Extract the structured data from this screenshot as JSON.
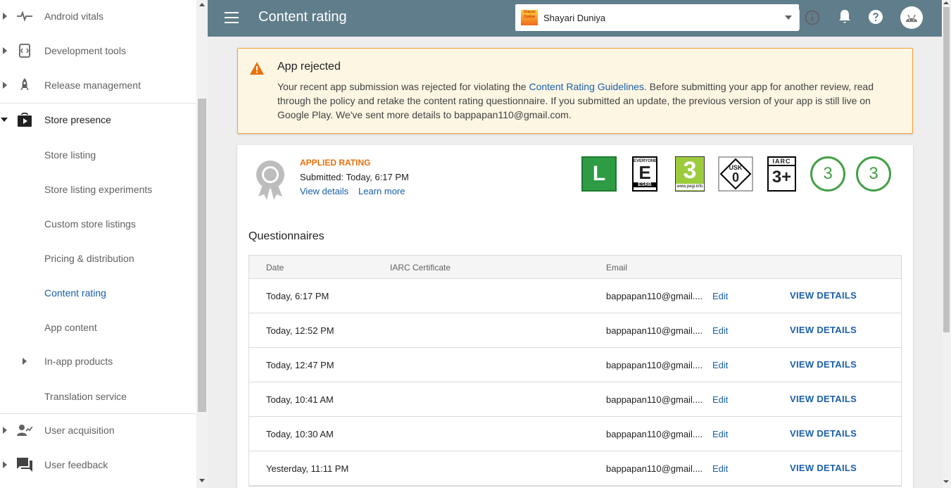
{
  "sidebar": {
    "items": [
      {
        "label": "Android vitals",
        "icon": "vitals-icon"
      },
      {
        "label": "Development tools",
        "icon": "dev-tools-icon"
      },
      {
        "label": "Release management",
        "icon": "rocket-icon"
      },
      {
        "label": "Store presence",
        "icon": "store-icon"
      },
      {
        "label": "Store listing"
      },
      {
        "label": "Store listing experiments"
      },
      {
        "label": "Custom store listings"
      },
      {
        "label": "Pricing & distribution"
      },
      {
        "label": "Content rating"
      },
      {
        "label": "App content"
      },
      {
        "label": "In-app products"
      },
      {
        "label": "Translation service"
      },
      {
        "label": "User acquisition",
        "icon": "user-acquisition-icon"
      },
      {
        "label": "User feedback",
        "icon": "feedback-icon"
      }
    ]
  },
  "header": {
    "title": "Content rating",
    "app_name": "Shayari Duniya",
    "app_logo_text": "Shayari Duniya"
  },
  "alert": {
    "title": "App rejected",
    "text_before": "Your recent app submission was rejected for violating the ",
    "link": "Content Rating Guidelines",
    "text_after": ". Before submitting your app for another review, read through the policy and retake the content rating questionnaire. If you submitted an update, the previous version of your app is still live on Google Play. We've sent more details to bappapan110@gmail.com."
  },
  "rating": {
    "label": "APPLIED RATING",
    "submitted": "Submitted: Today, 6:17 PM",
    "view_details": "View details",
    "learn_more": "Learn more",
    "badges": {
      "l": "L",
      "esrb_top": "EVERYONE",
      "esrb_letter": "E",
      "esrb_bottom": "ESRB",
      "pegi_number": "3",
      "pegi_site": "www.pegi.info",
      "usk_label": "USK",
      "usk_number": "0",
      "iarc_label": "IARC",
      "iarc_number": "3+",
      "circle1": "3",
      "circle2": "3"
    }
  },
  "questionnaires": {
    "title": "Questionnaires",
    "headers": {
      "date": "Date",
      "certificate": "IARC Certificate",
      "email": "Email"
    },
    "rows": [
      {
        "date": "Today, 6:17 PM",
        "email": "bappapan110@gmail....",
        "edit": "Edit",
        "view": "VIEW DETAILS"
      },
      {
        "date": "Today, 12:52 PM",
        "email": "bappapan110@gmail....",
        "edit": "Edit",
        "view": "VIEW DETAILS"
      },
      {
        "date": "Today, 12:47 PM",
        "email": "bappapan110@gmail....",
        "edit": "Edit",
        "view": "VIEW DETAILS"
      },
      {
        "date": "Today, 10:41 AM",
        "email": "bappapan110@gmail....",
        "edit": "Edit",
        "view": "VIEW DETAILS"
      },
      {
        "date": "Today, 10:30 AM",
        "email": "bappapan110@gmail....",
        "edit": "Edit",
        "view": "VIEW DETAILS"
      },
      {
        "date": "Yesterday, 11:11 PM",
        "email": "bappapan110@gmail....",
        "edit": "Edit",
        "view": "VIEW DETAILS"
      }
    ]
  }
}
